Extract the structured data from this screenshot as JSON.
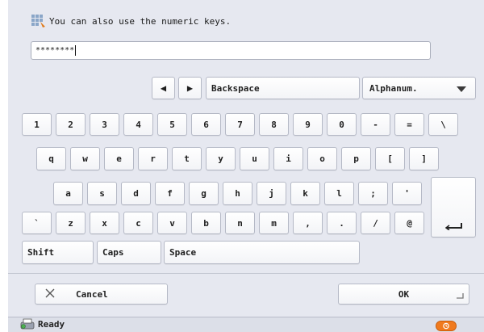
{
  "hint": {
    "text": "You can also use the numeric keys.",
    "icon": "numeric-keypad-icon"
  },
  "entry": {
    "value": "********"
  },
  "controls": {
    "left_arrow": "◀",
    "right_arrow": "▶",
    "backspace": "Backspace",
    "mode_value": "Alphanum."
  },
  "keyboard": {
    "row1": [
      "1",
      "2",
      "3",
      "4",
      "5",
      "6",
      "7",
      "8",
      "9",
      "0",
      "-",
      "=",
      "\\"
    ],
    "row2": [
      "q",
      "w",
      "e",
      "r",
      "t",
      "y",
      "u",
      "i",
      "o",
      "p",
      "[",
      "]"
    ],
    "row3": [
      "a",
      "s",
      "d",
      "f",
      "g",
      "h",
      "j",
      "k",
      "l",
      ";",
      "'"
    ],
    "row4": [
      "`",
      "z",
      "x",
      "c",
      "v",
      "b",
      "n",
      "m",
      ",",
      ".",
      "/",
      "@"
    ],
    "shift": "Shift",
    "caps": "Caps",
    "space": "Space",
    "enter_icon": "enter-icon"
  },
  "footer": {
    "cancel": "Cancel",
    "ok": "OK"
  },
  "status": {
    "text": "Ready",
    "icon": "printer-status-icon",
    "monitor_color": "#f07a1e"
  },
  "colors": {
    "background": "#e6e8f0",
    "key_border": "#b5b9c6"
  }
}
